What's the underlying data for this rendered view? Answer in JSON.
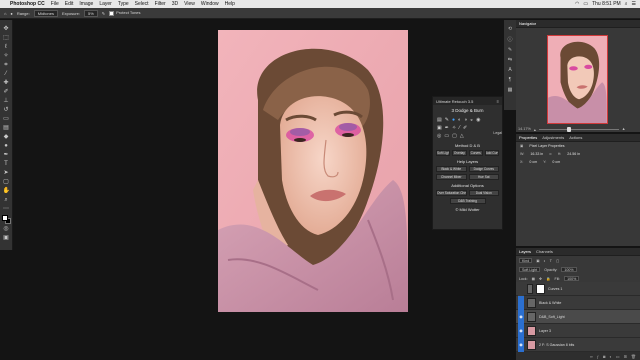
{
  "menubar": {
    "app": "Photoshop CC",
    "items": [
      "File",
      "Edit",
      "Image",
      "Layer",
      "Type",
      "Select",
      "Filter",
      "3D",
      "View",
      "Window",
      "Help"
    ],
    "clock": "Thu 8:51 PM"
  },
  "options": {
    "range_label": "Range:",
    "range_value": "Midtones",
    "exposure_label": "Exposure:",
    "exposure_value": "5%",
    "protect_tones": "Protect Tones"
  },
  "ur_panel": {
    "title": "Ultimate Retouch 3.5",
    "section": "3 Dodge & Burn",
    "method": "Method D & B",
    "help_layers": "Help Layers",
    "additional": "Additional Options",
    "help": "Legal",
    "row1": [
      "Soft Light",
      "Overlay",
      "Curves",
      "Add Curve"
    ],
    "row2": [
      "Black & White",
      "Dodge Curves"
    ],
    "row3": [
      "Channel Mixer",
      "Hue Sat"
    ],
    "row4": [
      "Over Saturation Check",
      "Dual Vision"
    ],
    "training": "D&B Training",
    "credit": "© Mild Wotter"
  },
  "navigator": {
    "tab": "Navigator",
    "zoom": "14.17%"
  },
  "properties": {
    "tabs": [
      "Properties",
      "Adjustments",
      "Actions"
    ],
    "header": "Pixel Layer Properties",
    "w_label": "W:",
    "w_value": "16.33 in",
    "h_label": "H:",
    "h_value": "24.56 in",
    "x_label": "X:",
    "x_value": "0 cm",
    "y_label": "Y:",
    "y_value": "0 cm"
  },
  "layers_panel": {
    "tabs": [
      "Layers",
      "Channels"
    ],
    "kind": "Kind",
    "blend": "Soft Light",
    "opacity_label": "Opacity:",
    "opacity_value": "100%",
    "lock_label": "Lock:",
    "fill_label": "Fill:",
    "fill_value": "100%",
    "layers": [
      {
        "name": "Curves 1",
        "visible": false,
        "thumb": "white"
      },
      {
        "name": "Black & White",
        "visible": true,
        "thumb": "grey"
      },
      {
        "name": "D&B_Soft_Light",
        "visible": true,
        "thumb": "grey"
      },
      {
        "name": "Layer 3",
        "visible": true,
        "thumb": "pink"
      },
      {
        "name": "2 F: S Gaussian 8 bits",
        "visible": true,
        "thumb": "pink"
      }
    ]
  }
}
